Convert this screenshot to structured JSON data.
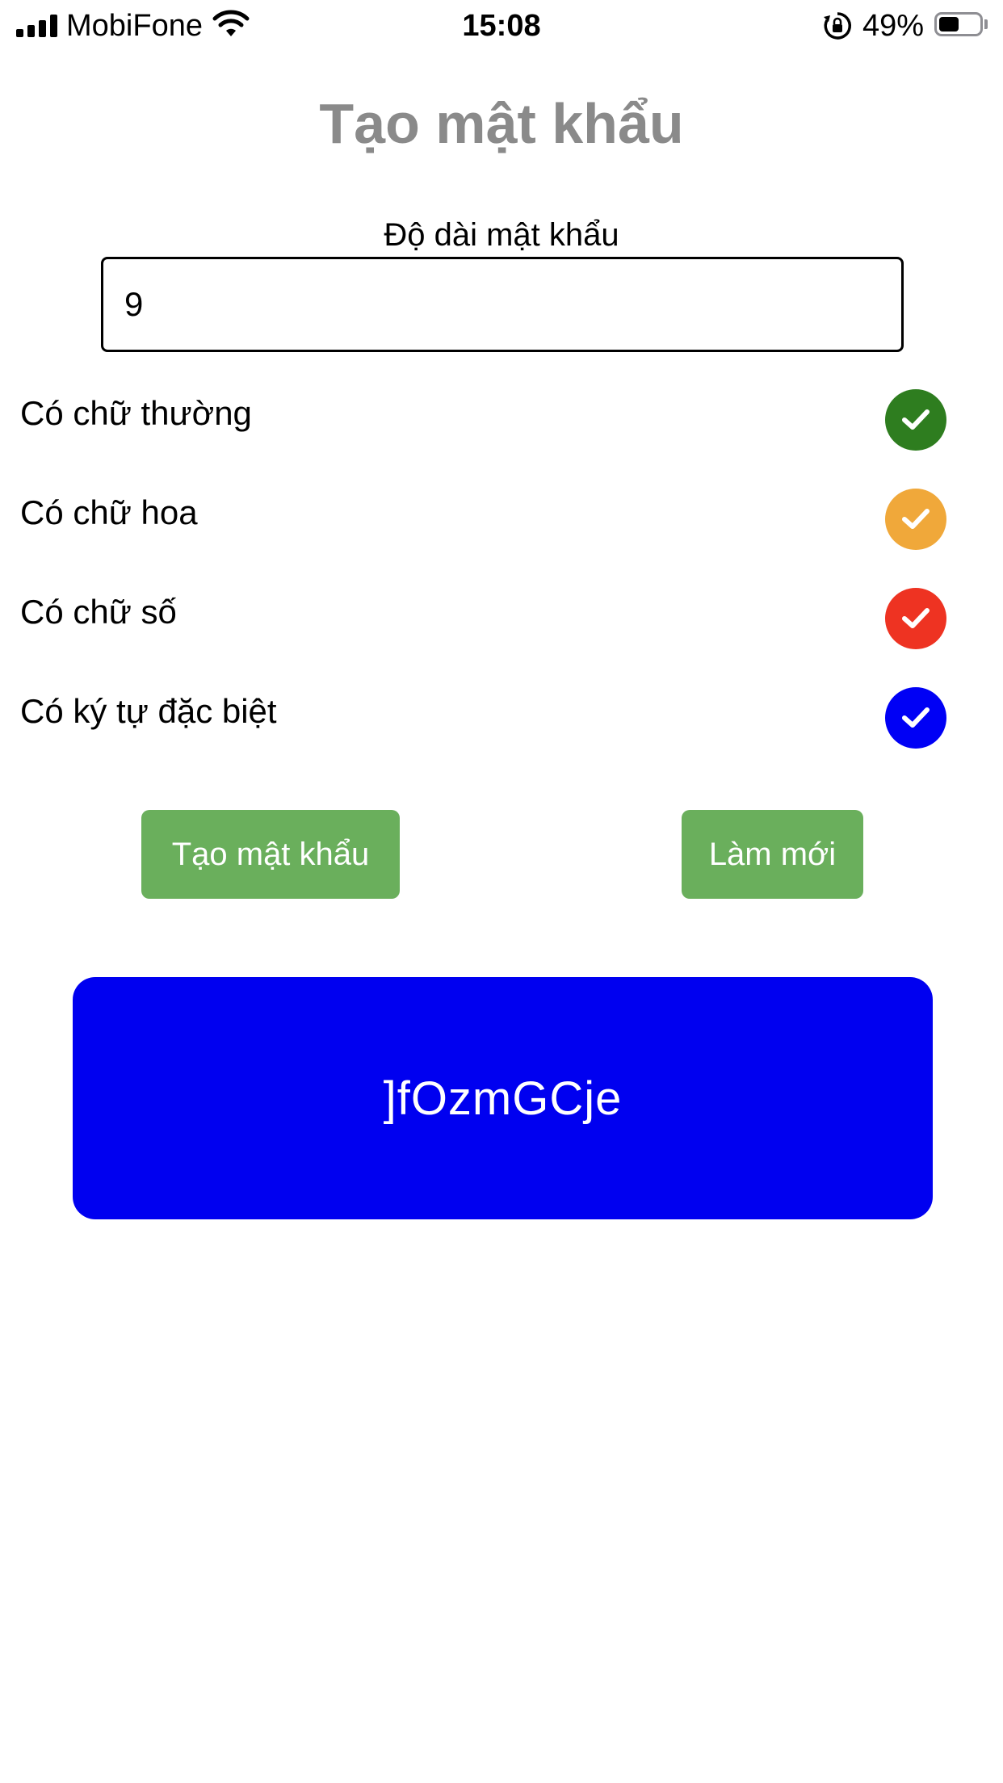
{
  "status_bar": {
    "carrier": "MobiFone",
    "time": "15:08",
    "battery_percent": "49%",
    "battery_level": 0.49,
    "icons": [
      "signal-icon",
      "wifi-icon",
      "rotation-lock-icon",
      "battery-icon"
    ]
  },
  "title": "Tạo mật khẩu",
  "length": {
    "label": "Độ dài mật khẩu",
    "value": "9"
  },
  "options": [
    {
      "label": "Có chữ thường",
      "color": "#2e7d1f",
      "checked": true,
      "icon": "check-icon"
    },
    {
      "label": "Có chữ hoa",
      "color": "#f0a83a",
      "checked": true,
      "icon": "check-icon"
    },
    {
      "label": "Có chữ số",
      "color": "#ee3322",
      "checked": true,
      "icon": "check-icon"
    },
    {
      "label": "Có ký tự đặc biệt",
      "color": "#0000f5",
      "checked": true,
      "icon": "check-icon"
    }
  ],
  "buttons": {
    "generate_label": "Tạo mật khẩu",
    "reset_label": "Làm mới",
    "color": "#6aaf5c"
  },
  "result": {
    "password": "]fOzmGCje",
    "background": "#0000f0"
  }
}
